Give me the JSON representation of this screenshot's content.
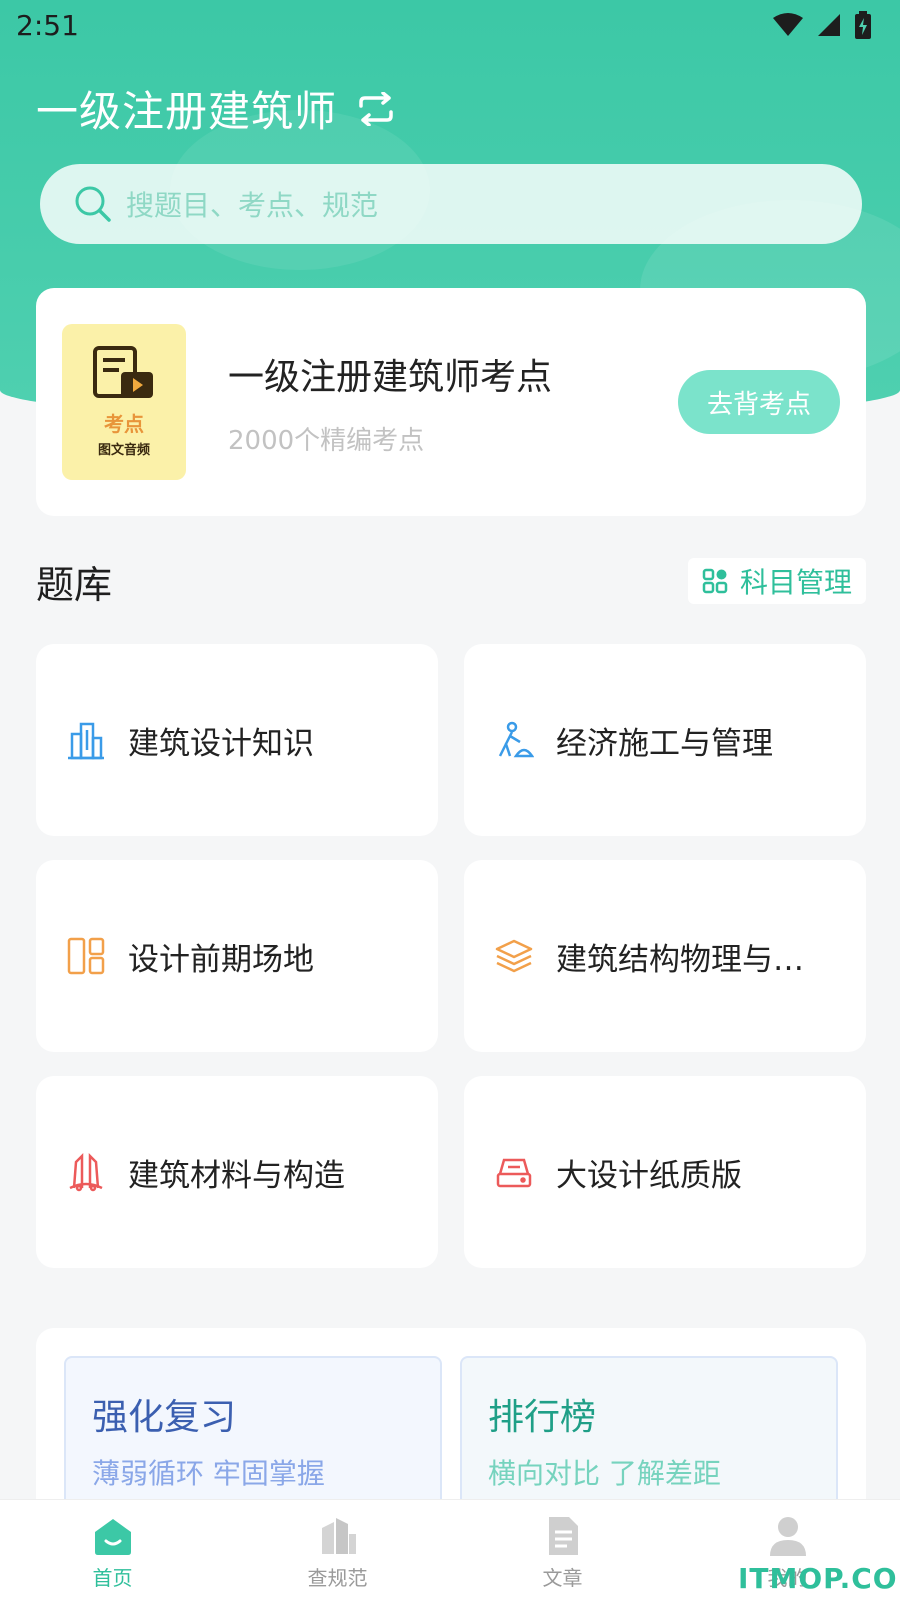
{
  "status_bar": {
    "time": "2:51"
  },
  "header": {
    "title": "一级注册建筑师",
    "switch_icon": "swap-icon"
  },
  "search": {
    "placeholder": "搜题目、考点、规范",
    "icon": "search-icon"
  },
  "kaodian_card": {
    "thumb_line1": "考点",
    "thumb_line2": "图文音频",
    "title": "一级注册建筑师考点",
    "subtitle": "2000个精编考点",
    "button": "去背考点"
  },
  "question_bank": {
    "title": "题库",
    "manage_label": "科目管理",
    "subjects": [
      {
        "label": "建筑设计知识",
        "icon": "building-icon",
        "color": "#3a9be8"
      },
      {
        "label": "经济施工与管理",
        "icon": "construction-worker-icon",
        "color": "#3a9be8"
      },
      {
        "label": "设计前期场地",
        "icon": "layout-icon",
        "color": "#f2a04a"
      },
      {
        "label": "建筑结构物理与…",
        "icon": "layers-icon",
        "color": "#f2a04a"
      },
      {
        "label": "建筑材料与构造",
        "icon": "materials-icon",
        "color": "#ec5a5a"
      },
      {
        "label": "大设计纸质版",
        "icon": "drive-icon",
        "color": "#ec5a5a"
      }
    ]
  },
  "features": [
    {
      "title": "强化复习",
      "desc": "薄弱循环 牢固掌握",
      "title_color": "#3b5fb0",
      "desc_color": "#8aa7e8"
    },
    {
      "title": "排行榜",
      "desc": "横向对比 了解差距",
      "title_color": "#1f9f87",
      "desc_color": "#76d3be"
    }
  ],
  "tabbar": [
    {
      "label": "首页",
      "icon": "home-icon",
      "active": true
    },
    {
      "label": "查规范",
      "icon": "buildings-icon",
      "active": false
    },
    {
      "label": "文章",
      "icon": "document-icon",
      "active": false
    },
    {
      "label": "我的",
      "icon": "user-icon",
      "active": false
    }
  ],
  "watermark": "ITMOP.COM"
}
